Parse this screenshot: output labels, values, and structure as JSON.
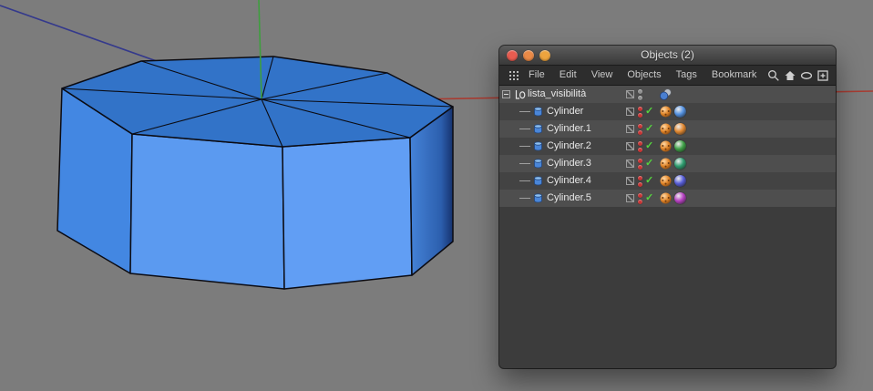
{
  "viewport": {
    "background_color": "#7c7c7c",
    "object_name": "octagonal cylinder",
    "object_color": "#3f82dc",
    "axes": {
      "x_color": "#a83c32",
      "y_color": "#3f9e3f",
      "z_color": "#34398c"
    }
  },
  "window": {
    "title": "Objects (2)",
    "traffic_lights": [
      "close",
      "minimize",
      "zoom"
    ],
    "menus": [
      "File",
      "Edit",
      "View",
      "Objects",
      "Tags",
      "Bookmark"
    ],
    "toolbar_icons": [
      "search",
      "home",
      "eye",
      "detach"
    ],
    "glyphs": {
      "check": "✓"
    },
    "visibility_dot_color": "#c83434",
    "tree": {
      "root": {
        "name": "lista_visibilità"
      },
      "children": [
        {
          "name": "Cylinder",
          "material_color": "#5290e0"
        },
        {
          "name": "Cylinder.1",
          "material_color": "#e0862e"
        },
        {
          "name": "Cylinder.2",
          "material_color": "#3da045"
        },
        {
          "name": "Cylinder.3",
          "material_color": "#2c9c6e"
        },
        {
          "name": "Cylinder.4",
          "material_color": "#565cd8"
        },
        {
          "name": "Cylinder.5",
          "material_color": "#b53ec0"
        }
      ]
    }
  }
}
